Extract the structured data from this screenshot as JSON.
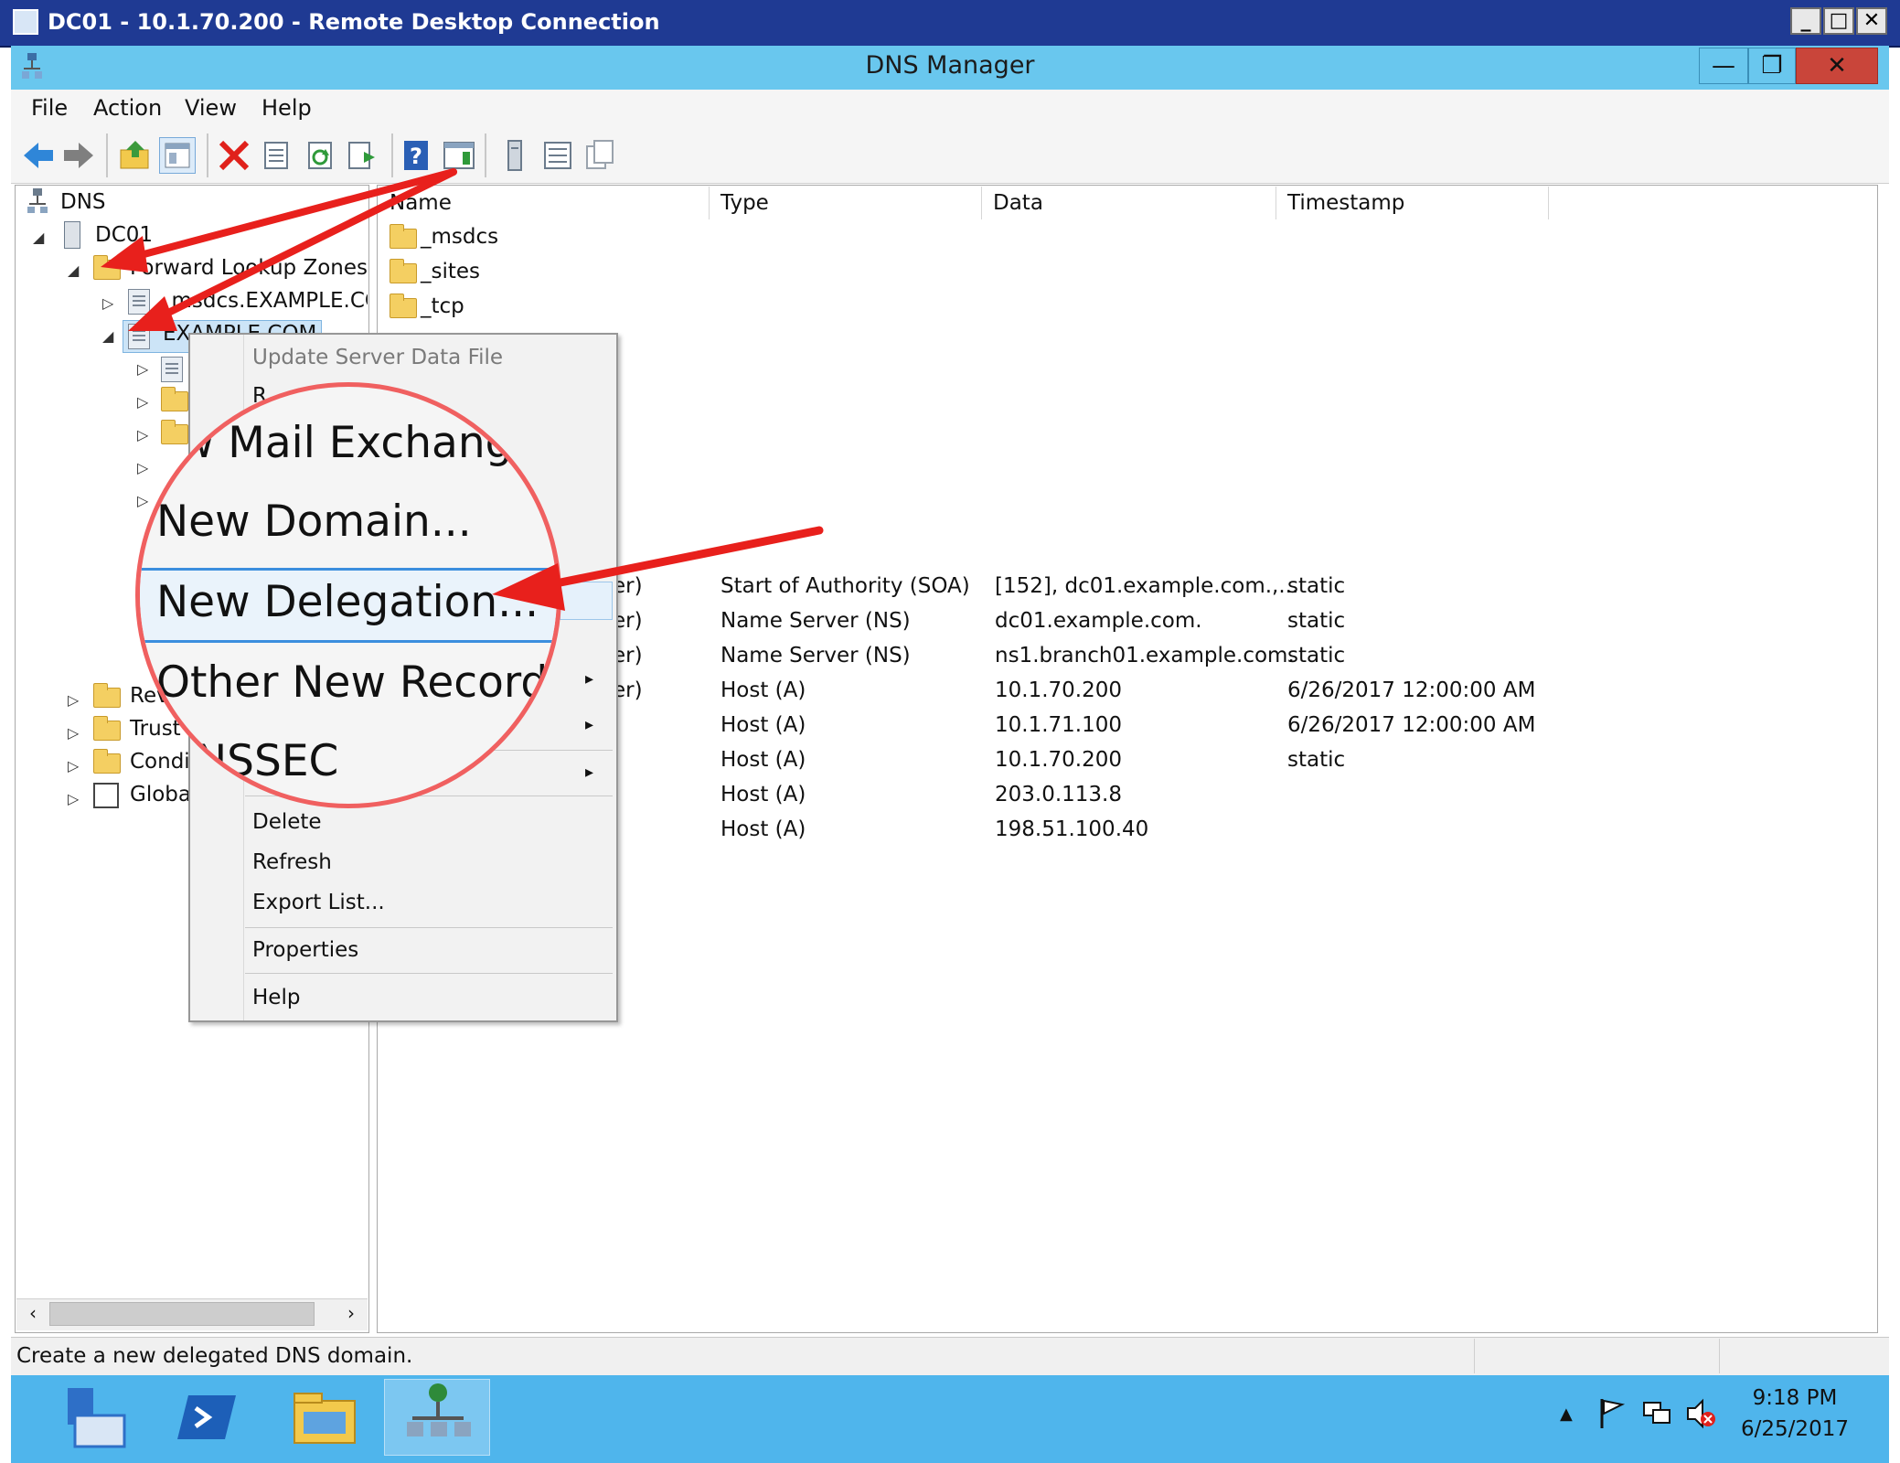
{
  "rdp": {
    "title": "DC01 - 10.1.70.200 - Remote Desktop Connection",
    "min": "_",
    "max": "□",
    "close": "✕"
  },
  "window": {
    "title": "DNS Manager",
    "min": "—",
    "restore": "❐",
    "close": "✕"
  },
  "menu": [
    "File",
    "Action",
    "View",
    "Help"
  ],
  "tree": {
    "root": "DNS",
    "server": "DC01",
    "forward_zones": "Forward Lookup Zones",
    "msdcs_zone": "_msdcs.EXAMPLE.CC",
    "example_zone": "EXAMPLE.COM",
    "reverse_partial": "Rev",
    "trust_partial": "Trust",
    "cond_partial": "Condi",
    "global_partial": "Globa"
  },
  "columns": [
    "Name",
    "Type",
    "Data",
    "Timestamp"
  ],
  "folders": [
    "_msdcs",
    "_sites",
    "_tcp"
  ],
  "records": [
    {
      "name": "er)",
      "type": "Start of Authority (SOA)",
      "data": "[152], dc01.example.com.,...",
      "timestamp": "static"
    },
    {
      "name": "er)",
      "type": "Name Server (NS)",
      "data": "dc01.example.com.",
      "timestamp": "static"
    },
    {
      "name": "er)",
      "type": "Name Server (NS)",
      "data": "ns1.branch01.example.com.",
      "timestamp": "static"
    },
    {
      "name": "er)",
      "type": "Host (A)",
      "data": "10.1.70.200",
      "timestamp": "6/26/2017 12:00:00 AM"
    },
    {
      "name": "",
      "type": "Host (A)",
      "data": "10.1.71.100",
      "timestamp": "6/26/2017 12:00:00 AM"
    },
    {
      "name": "",
      "type": "Host (A)",
      "data": "10.1.70.200",
      "timestamp": "static"
    },
    {
      "name": "",
      "type": "Host (A)",
      "data": "203.0.113.8",
      "timestamp": ""
    },
    {
      "name": "",
      "type": "Host (A)",
      "data": "198.51.100.40",
      "timestamp": ""
    }
  ],
  "context_menu": {
    "update": "Update Server Data File",
    "reload_partial": "R",
    "delete": "Delete",
    "refresh": "Refresh",
    "export": "Export List...",
    "properties": "Properties",
    "help": "Help",
    "submenu_arrow": "▸"
  },
  "magnifier": {
    "mail": "ew Mail Exchang",
    "domain": "New Domain...",
    "delegation": "New Delegation...",
    "other": "Other New Records.",
    "dnssec": "NSSEC"
  },
  "status": "Create a new delegated DNS domain.",
  "clock": {
    "time": "9:18 PM",
    "date": "6/25/2017"
  },
  "colors": {
    "taskbar": "#4fb5ec",
    "titlebar": "#69c7ee",
    "arrow": "#e8201c",
    "highlight": "#3b8ede"
  }
}
